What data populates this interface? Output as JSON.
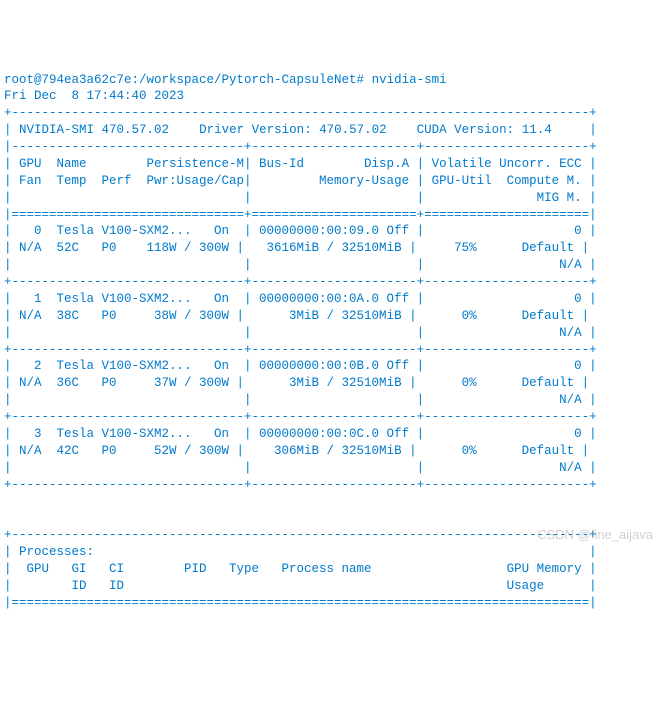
{
  "prompt": "root@794ea3a62c7e:/workspace/Pytorch-CapsuleNet# ",
  "command": "nvidia-smi",
  "timestamp": "Fri Dec  8 17:44:40 2023",
  "header": {
    "smi_version_label": "NVIDIA-SMI",
    "smi_version": "470.57.02",
    "driver_version_label": "Driver Version:",
    "driver_version": "470.57.02",
    "cuda_version_label": "CUDA Version:",
    "cuda_version": "11.4"
  },
  "col_header": {
    "line1": "| GPU  Name        Persistence-M| Bus-Id        Disp.A | Volatile Uncorr. ECC |",
    "line2": "| Fan  Temp  Perf  Pwr:Usage/Cap|         Memory-Usage | GPU-Util  Compute M. |",
    "line3": "|                               |                      |               MIG M. |"
  },
  "gpus": [
    {
      "idx": "0",
      "name": "Tesla V100-SXM2...",
      "persist": "On",
      "busid": "00000000:00:09.0",
      "disp": "Off",
      "ecc": "0",
      "fan": "N/A",
      "temp": "52C",
      "perf": "P0",
      "pwr": "118W / 300W",
      "mem": "3616MiB / 32510MiB",
      "util": "75%",
      "compute": "Default",
      "mig": "N/A"
    },
    {
      "idx": "1",
      "name": "Tesla V100-SXM2...",
      "persist": "On",
      "busid": "00000000:00:0A.0",
      "disp": "Off",
      "ecc": "0",
      "fan": "N/A",
      "temp": "38C",
      "perf": "P0",
      "pwr": "38W / 300W",
      "mem": "3MiB / 32510MiB",
      "util": "0%",
      "compute": "Default",
      "mig": "N/A"
    },
    {
      "idx": "2",
      "name": "Tesla V100-SXM2...",
      "persist": "On",
      "busid": "00000000:00:0B.0",
      "disp": "Off",
      "ecc": "0",
      "fan": "N/A",
      "temp": "36C",
      "perf": "P0",
      "pwr": "37W / 300W",
      "mem": "3MiB / 32510MiB",
      "util": "0%",
      "compute": "Default",
      "mig": "N/A"
    },
    {
      "idx": "3",
      "name": "Tesla V100-SXM2...",
      "persist": "On",
      "busid": "00000000:00:0C.0",
      "disp": "Off",
      "ecc": "0",
      "fan": "N/A",
      "temp": "42C",
      "perf": "P0",
      "pwr": "52W / 300W",
      "mem": "306MiB / 32510MiB",
      "util": "0%",
      "compute": "Default",
      "mig": "N/A"
    }
  ],
  "processes": {
    "header": "| Processes:                                                                  |",
    "cols1": "|  GPU   GI   CI        PID   Type   Process name                  GPU Memory |",
    "cols2": "|        ID   ID                                                   Usage      |"
  },
  "watermark": "CSDN @fine_aijava"
}
